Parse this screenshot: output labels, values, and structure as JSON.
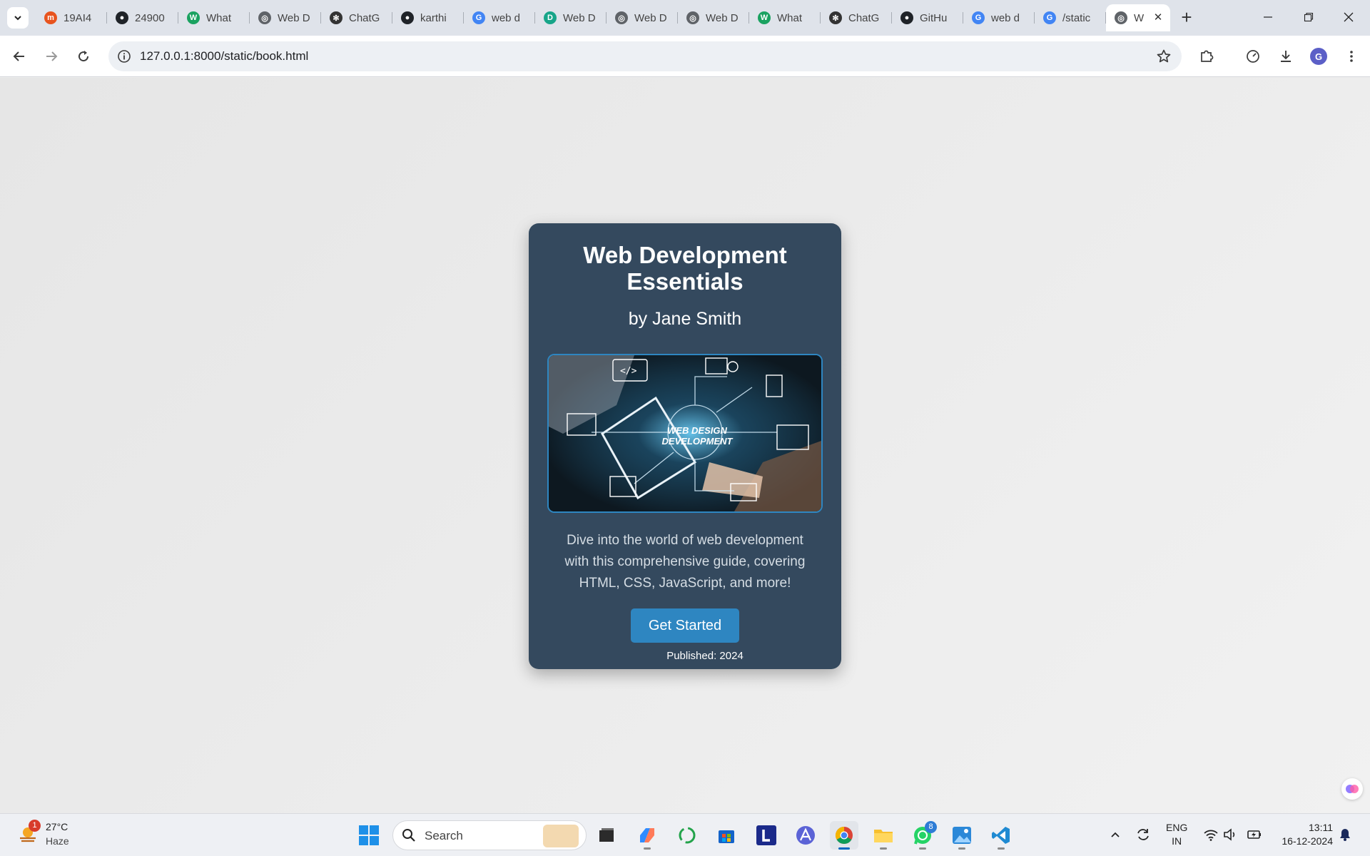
{
  "browser": {
    "tabs": [
      {
        "label": "19AI4",
        "favicon": "fire-favicon",
        "color": "#e8541e"
      },
      {
        "label": "24900",
        "favicon": "github-favicon",
        "color": "#1f2328"
      },
      {
        "label": "What",
        "favicon": "w-favicon",
        "color": "#1aa260"
      },
      {
        "label": "Web D",
        "favicon": "globe-favicon",
        "color": "#5f6368"
      },
      {
        "label": "ChatG",
        "favicon": "chatgpt-favicon",
        "color": "#333333"
      },
      {
        "label": "karthi",
        "favicon": "github-favicon",
        "color": "#1f2328"
      },
      {
        "label": "web d",
        "favicon": "google-favicon",
        "color": "#4285f4"
      },
      {
        "label": "Web D",
        "favicon": "d-favicon",
        "color": "#17a589"
      },
      {
        "label": "Web D",
        "favicon": "globe-favicon",
        "color": "#5f6368"
      },
      {
        "label": "Web D",
        "favicon": "globe-favicon",
        "color": "#5f6368"
      },
      {
        "label": "What",
        "favicon": "w-favicon",
        "color": "#1aa260"
      },
      {
        "label": "ChatG",
        "favicon": "chatgpt-favicon",
        "color": "#333333"
      },
      {
        "label": "GitHu",
        "favicon": "github-favicon",
        "color": "#1f2328"
      },
      {
        "label": "web d",
        "favicon": "google-favicon",
        "color": "#4285f4"
      },
      {
        "label": "/static",
        "favicon": "google-favicon",
        "color": "#4285f4"
      }
    ],
    "active_tab": {
      "label": "W",
      "favicon": "globe-favicon"
    },
    "url": "127.0.0.1:8000/static/book.html",
    "profile_initial": "G"
  },
  "book": {
    "title": "Web Development Essentials",
    "author": "by Jane Smith",
    "cover_text": "WEB DESIGN DEVELOPMENT",
    "description": "Dive into the world of web development with this comprehensive guide, covering HTML, CSS, JavaScript, and more!",
    "button_label": "Get Started",
    "published": "Published: 2024"
  },
  "taskbar": {
    "weather_temp": "27°C",
    "weather_desc": "Haze",
    "weather_badge": "1",
    "search_placeholder": "Search",
    "whatsapp_badge": "8",
    "lang_line1": "ENG",
    "lang_line2": "IN",
    "time": "13:11",
    "date": "16-12-2024"
  },
  "colors": {
    "card_bg": "#34495e",
    "accent": "#2e86c1",
    "page_bg": "#ececec"
  }
}
